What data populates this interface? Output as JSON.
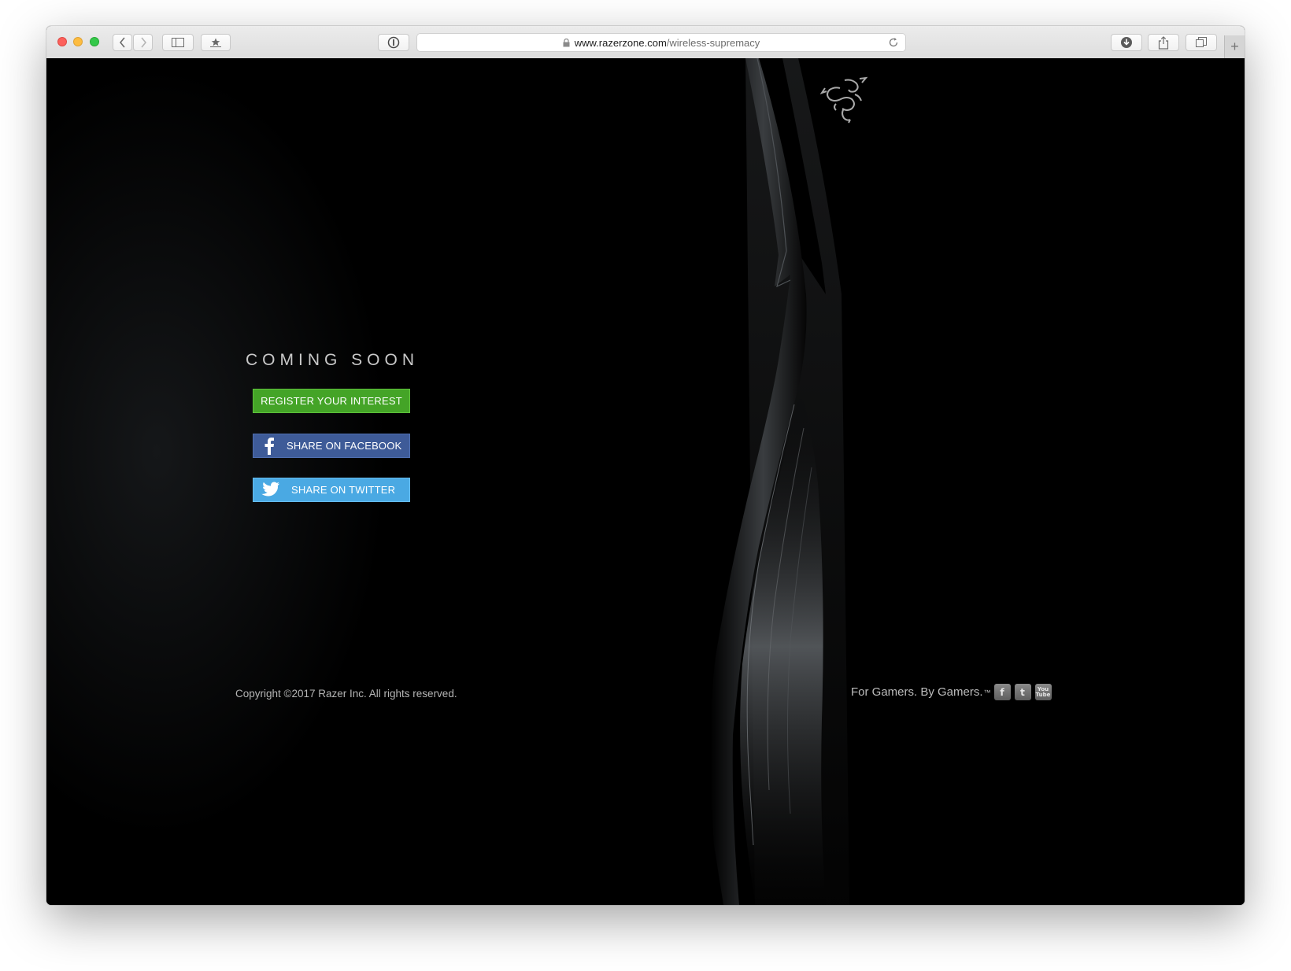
{
  "browser": {
    "url_host": "www.razerzone.com",
    "url_path": "/wireless-supremacy"
  },
  "page": {
    "heading": "COMING SOON",
    "buttons": {
      "register": "REGISTER YOUR INTEREST",
      "facebook": "SHARE ON FACEBOOK",
      "twitter": "SHARE ON TWITTER"
    },
    "copyright": "Copyright ©2017 Razer Inc. All rights reserved.",
    "tagline": "For Gamers. By Gamers.",
    "tagline_mark": "™",
    "social_icons": {
      "facebook": "f",
      "twitter": "t",
      "youtube_top": "You",
      "youtube_bottom": "Tube"
    }
  },
  "colors": {
    "register": "#44a427",
    "facebook": "#3e5b98",
    "twitter": "#4aa9e3"
  }
}
